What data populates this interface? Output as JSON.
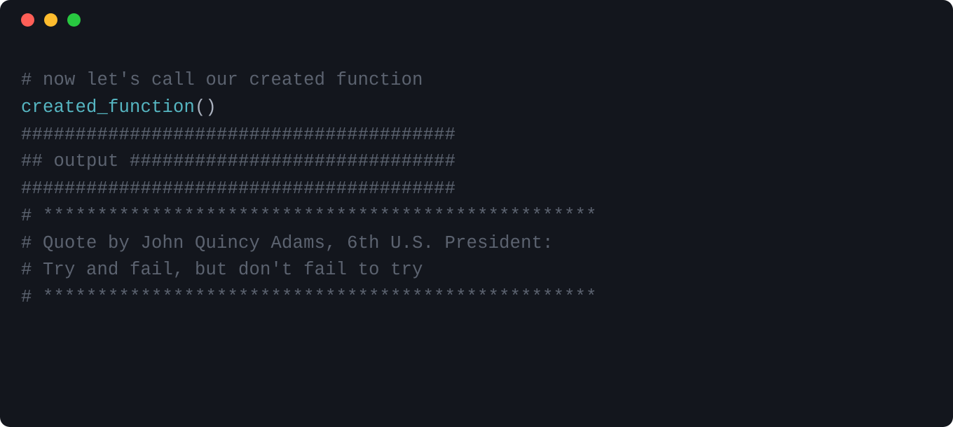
{
  "code": {
    "line1_comment": "# now let's call our created function",
    "line2_func": "created_function",
    "line2_parens": "()",
    "line3": "",
    "line4_comment": "########################################",
    "line5_comment": "## output ##############################",
    "line6_comment": "########################################",
    "line7": "",
    "line8": "",
    "line9_comment": "# ***************************************************",
    "line10_comment": "# Quote by John Quincy Adams, 6th U.S. President:",
    "line11_comment": "# Try and fail, but don't fail to try",
    "line12_comment": "# ***************************************************"
  }
}
